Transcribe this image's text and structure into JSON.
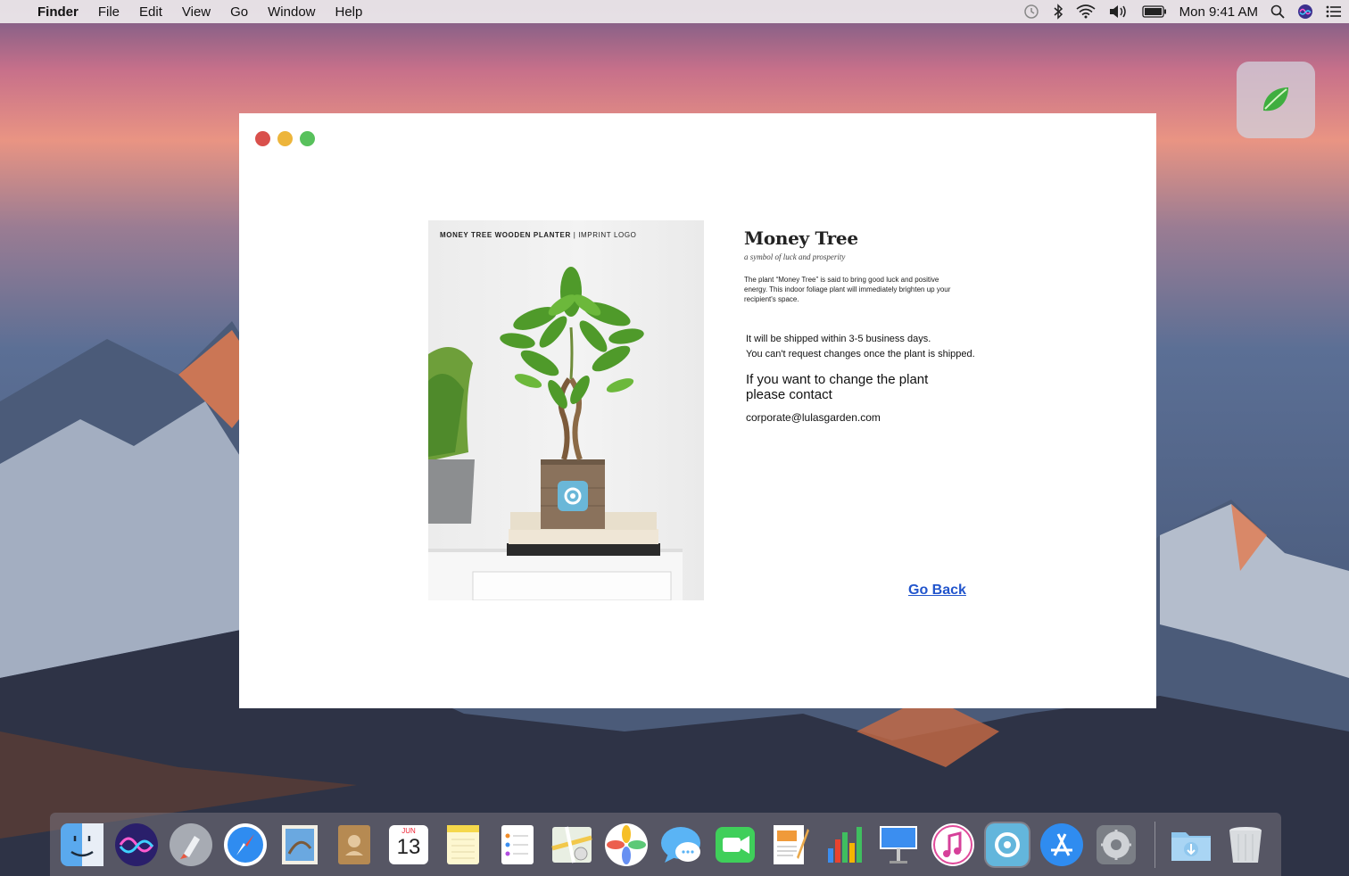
{
  "menubar": {
    "app_name": "Finder",
    "menus": [
      "File",
      "Edit",
      "View",
      "Go",
      "Window",
      "Help"
    ],
    "clock": "Mon 9:41 AM",
    "status_icons": [
      "time-machine-icon",
      "bluetooth-icon",
      "wifi-icon",
      "volume-icon",
      "battery-icon",
      "spotlight-icon",
      "siri-icon",
      "notification-center-icon"
    ]
  },
  "widget": {
    "icon": "leaf-icon",
    "color": "#3fae3f"
  },
  "window": {
    "product": {
      "image_caption_bold": "MONEY TREE WOODEN PLANTER",
      "image_caption_rest": "| IMPRINT LOGO",
      "title": "Money Tree",
      "subtitle": "a symbol of luck and prosperity",
      "description": "The plant “Money Tree” is said to bring good luck and positive energy. This indoor foliage plant will immediately brighten up your recipient's space."
    },
    "shipping_line1": "It will be shipped within 3-5 business days.",
    "shipping_line2": "You can't request changes once the plant is shipped.",
    "change_text": "If you want to change the plant please contact",
    "contact_email": "corporate@lulasgarden.com",
    "go_back_label": "Go Back",
    "link_color": "#2255cc"
  },
  "dock": {
    "apps": [
      "finder",
      "siri",
      "launchpad",
      "safari",
      "mail",
      "contacts",
      "calendar",
      "notes",
      "reminders",
      "maps",
      "photos",
      "messages",
      "facetime",
      "pages",
      "numbers",
      "keynote",
      "itunes",
      "plant-app",
      "app-store",
      "system-preferences"
    ],
    "calendar_month": "JUN",
    "calendar_day": "13",
    "right_items": [
      "downloads-folder",
      "trash"
    ]
  }
}
